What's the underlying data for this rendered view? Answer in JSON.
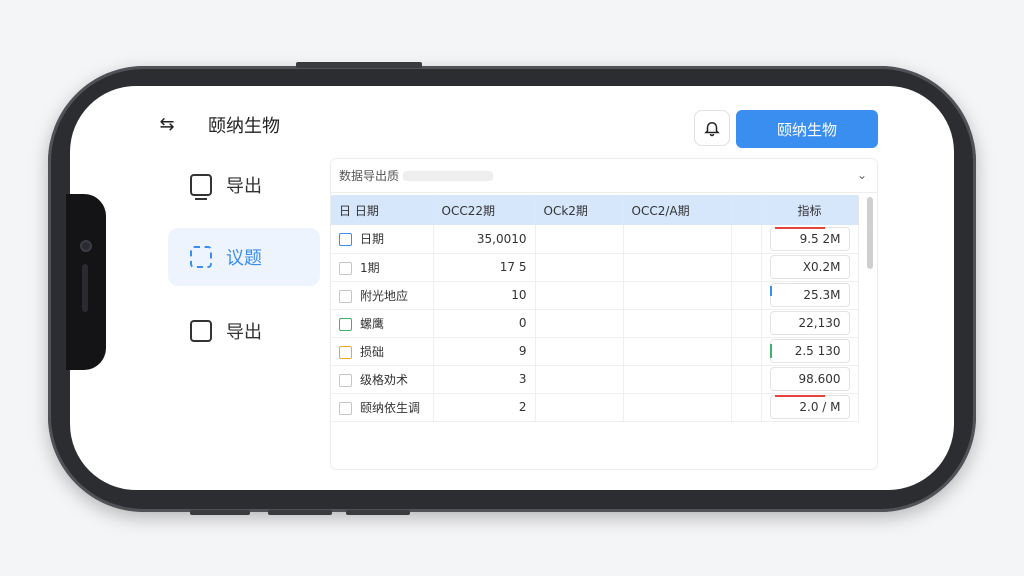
{
  "header": {
    "back_icon": "back-icon",
    "title": "颐纳生物",
    "primary_button": "颐纳生物",
    "bell_icon": "bell-icon"
  },
  "sidebar": {
    "items": [
      {
        "label": "导出",
        "icon": "monitor-icon",
        "active": false
      },
      {
        "label": "议题",
        "icon": "document-check-icon",
        "active": true
      },
      {
        "label": "导出",
        "icon": "checkbox-icon",
        "active": false
      }
    ]
  },
  "panel": {
    "dropdown_label": "数据导出质",
    "columns": [
      "日 日期",
      "OCC22期",
      "OCk2期",
      "OCC2/A期",
      "",
      "指标"
    ],
    "rows": [
      {
        "label": "日期",
        "c1": "35,0010",
        "c2": "",
        "c3": "",
        "indicator": "9.5 2M",
        "cb": "blue",
        "mark": "red"
      },
      {
        "label": "1期",
        "c1": "17 5",
        "c2": "",
        "c3": "",
        "indicator": "X0.2M",
        "cb": "",
        "mark": ""
      },
      {
        "label": "附光地应",
        "c1": "10",
        "c2": "",
        "c3": "",
        "indicator": "25.3M",
        "cb": "",
        "mark": "blue"
      },
      {
        "label": "螺鹰",
        "c1": "0",
        "c2": "",
        "c3": "",
        "indicator": "22,130",
        "cb": "green",
        "mark": ""
      },
      {
        "label": "损础",
        "c1": "9",
        "c2": "",
        "c3": "",
        "indicator": "2.5 130",
        "cb": "orange",
        "mark": "green"
      },
      {
        "label": "级格劝术",
        "c1": "3",
        "c2": "",
        "c3": "",
        "indicator": "98.600",
        "cb": "",
        "mark": ""
      },
      {
        "label": "颐纳依生调",
        "c1": "2",
        "c2": "",
        "c3": "",
        "indicator": "2.0 / M",
        "cb": "",
        "mark": "red"
      }
    ]
  },
  "colors": {
    "accent": "#3a8ef0",
    "header_row": "#d6e6fb",
    "active_nav": "#eef4fd"
  }
}
